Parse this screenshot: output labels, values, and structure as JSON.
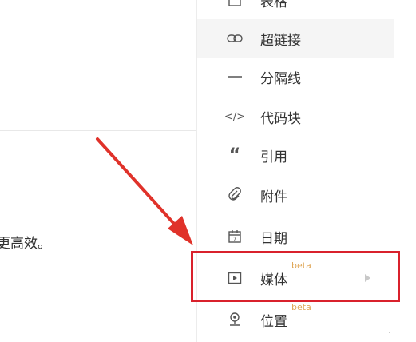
{
  "editor": {
    "body_text": "更高效。"
  },
  "menu": {
    "items": [
      {
        "label": "表格",
        "icon": "table-icon",
        "beta": ""
      },
      {
        "label": "超链接",
        "icon": "link-icon",
        "beta": ""
      },
      {
        "label": "分隔线",
        "icon": "divider-icon",
        "beta": ""
      },
      {
        "label": "代码块",
        "icon": "code-block-icon",
        "beta": ""
      },
      {
        "label": "引用",
        "icon": "quote-icon",
        "beta": ""
      },
      {
        "label": "附件",
        "icon": "paperclip-icon",
        "beta": ""
      },
      {
        "label": "日期",
        "icon": "calendar-icon",
        "beta": ""
      },
      {
        "label": "媒体",
        "icon": "media-play-icon",
        "beta": "beta"
      },
      {
        "label": "位置",
        "icon": "location-pin-icon",
        "beta": "beta"
      }
    ]
  },
  "colors": {
    "highlight": "#d9212c",
    "beta": "#e0a85a",
    "hover_bg": "#f5f5f5"
  }
}
